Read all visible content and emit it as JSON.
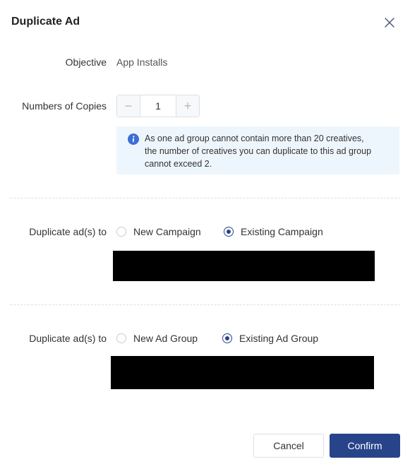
{
  "dialog": {
    "title": "Duplicate Ad"
  },
  "objective": {
    "label": "Objective",
    "value": "App Installs"
  },
  "copies": {
    "label": "Numbers of Copies",
    "value": "1",
    "decrement": "−",
    "increment": "+"
  },
  "notice": {
    "line1": "As one ad group cannot contain more than 20 creatives,",
    "line2": "the number of creatives you can duplicate to this ad group",
    "line3": "cannot exceed 2."
  },
  "campaign_target": {
    "label": "Duplicate ad(s) to",
    "options": [
      {
        "label": "New Campaign",
        "selected": false
      },
      {
        "label": "Existing Campaign",
        "selected": true
      }
    ]
  },
  "adgroup_target": {
    "label": "Duplicate ad(s) to",
    "options": [
      {
        "label": "New Ad Group",
        "selected": false
      },
      {
        "label": "Existing Ad Group",
        "selected": true
      }
    ]
  },
  "footer": {
    "cancel_label": "Cancel",
    "confirm_label": "Confirm"
  },
  "colors": {
    "primary": "#27448a",
    "info_bg": "#eef6fd",
    "info_icon": "#3b6fd4"
  },
  "icons": {
    "close": "close-icon",
    "info": "info-icon"
  }
}
